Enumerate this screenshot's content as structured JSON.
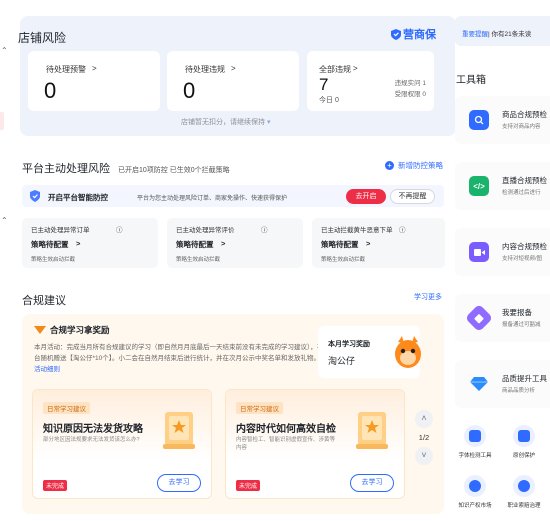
{
  "risk": {
    "title": "店铺风险",
    "brand": "营商保",
    "pending_warning": {
      "label": "待处理预警",
      "value": "0"
    },
    "pending_violation": {
      "label": "待处理违规",
      "value": "0"
    },
    "all_violation": {
      "label": "全部违规",
      "value": "7",
      "today": "今日 0",
      "side1": "违规实问 1",
      "side2": "受限权限 0"
    },
    "footer": "店铺暂无扣分，请继续保持"
  },
  "platform": {
    "title": "平台主动处理风险",
    "subtitle": "已开启10项防控 已生效0个拦截策略",
    "new_policy": "新增防控策略",
    "smart_title": "开启平台智能防控",
    "smart_desc": "平台为您主动处理风险订单、商家免操作、快速获得保护",
    "btn_on": "去开启",
    "btn_no": "不再提醒",
    "cards": [
      {
        "a": "已主动处理异常订单",
        "b": "策略待配置",
        "c": "策略生效启动拦截"
      },
      {
        "a": "已主动处理异常评价",
        "b": "策略待配置",
        "c": "策略生效启动拦截"
      },
      {
        "a": "已主动拦截黄牛恶意下单",
        "b": "策略待配置",
        "c": "策略生效启动拦截"
      }
    ]
  },
  "compliance": {
    "title": "合规建议",
    "learn_more": "学习更多",
    "promo_title": "合规学习拿奖励",
    "promo_desc": "本月活动：完成当月所有合规建议的学习（即自然月月底最后一天结束前没有未完成的学习建议），平台随机赠送【淘公仔*10个】。小二会在自然月结束后进行统计，并在次月公示中奖名单和发放礼物。",
    "promo_link": "活动细则",
    "award_title": "本月学习奖励",
    "award_value": "淘公仔",
    "studies": [
      {
        "tag": "日常学习建议",
        "title": "知识原因无法发货攻略",
        "desc": "部分地区因法规要求无法发货该怎么办?",
        "badge": "未完成",
        "go": "去学习"
      },
      {
        "tag": "日常学习建议",
        "title": "内容时代如何高效自检",
        "desc": "内容智检工、智能识别虚假宣传、涉黄等内容",
        "badge": "未完成",
        "go": "去学习"
      }
    ],
    "pager": "1/2"
  },
  "right": {
    "notice_highlight": "重要提醒",
    "notice_text": "| 你有21条未读",
    "tools_title": "工具箱",
    "tools": [
      {
        "title": "商品合规预检",
        "desc": "支持对商品内容",
        "icon": "search-shield-icon",
        "color": "#2f6bff"
      },
      {
        "title": "直播合规预检",
        "desc": "检测通过后进行",
        "icon": "code-icon",
        "color": "#19b36b"
      },
      {
        "title": "内容合规预检",
        "desc": "支持对短视频/图",
        "icon": "video-icon",
        "color": "#7b5cff"
      },
      {
        "title": "我要报备",
        "desc": "报备通过可豁减",
        "icon": "report-icon",
        "color": "#8f6bff"
      },
      {
        "title": "品质提升工具",
        "desc": "商品品质分析",
        "icon": "diamond-icon",
        "color": "#2a8cff"
      }
    ],
    "mini": [
      {
        "title": "字体检测工具"
      },
      {
        "title": "原创保护"
      },
      {
        "title": "知识产权市场"
      },
      {
        "title": "职业索赔治理"
      }
    ]
  }
}
